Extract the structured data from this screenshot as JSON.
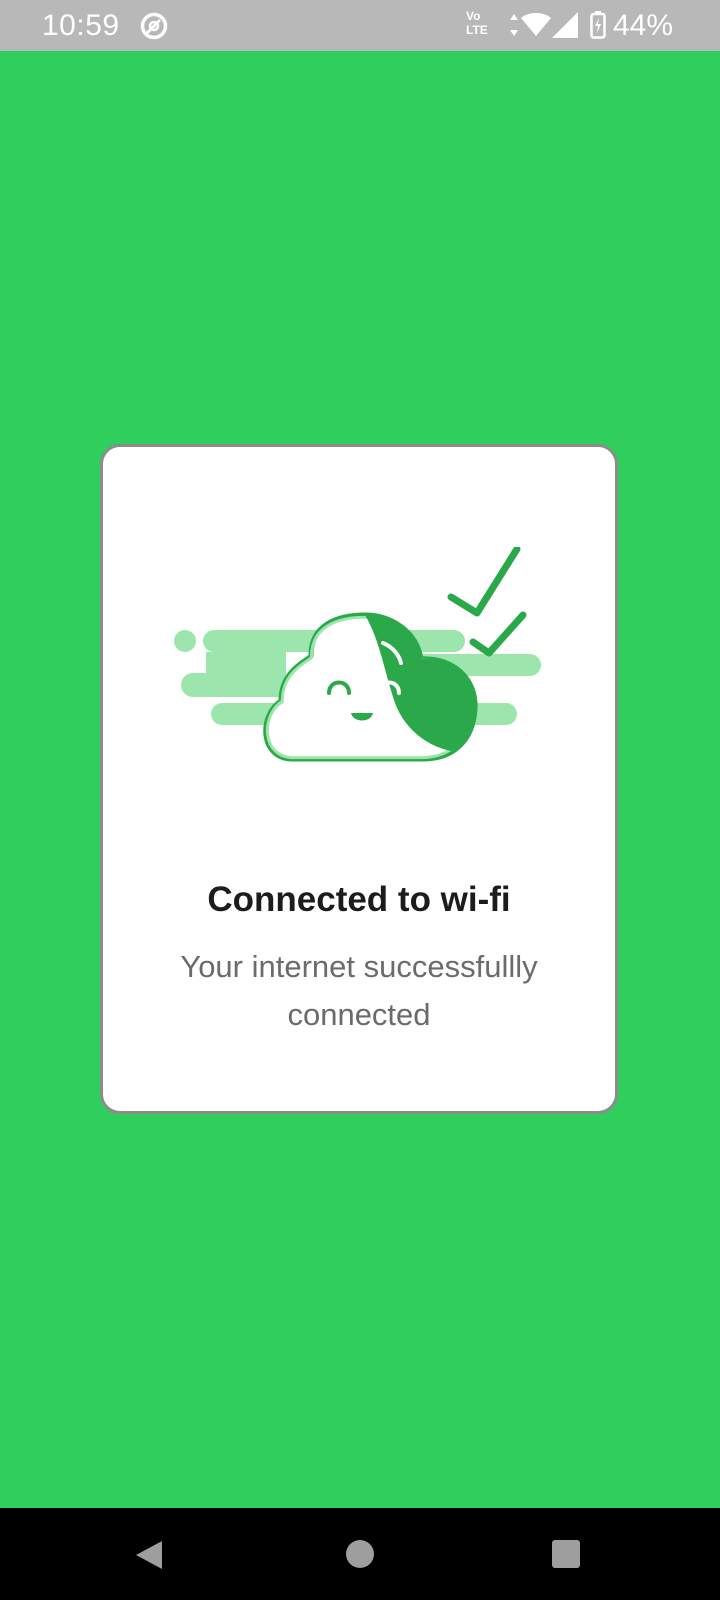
{
  "status_bar": {
    "time": "10:59",
    "volte_top": "Vo",
    "volte_bottom": "LTE",
    "battery_percent": "44%",
    "icons": [
      "app-notification-icon",
      "volte-icon",
      "data-arrows-icon",
      "wifi-icon",
      "cellular-signal-icon",
      "battery-charging-icon"
    ]
  },
  "dialog": {
    "title": "Connected to wi-fi",
    "message": "Your internet successfullly connected",
    "illustration": "happy-cloud-checkmark-icon"
  },
  "nav_bar": {
    "icons": [
      "back-icon",
      "home-icon",
      "recents-icon"
    ]
  },
  "colors": {
    "background": "#30CE5C",
    "status_bar": "#B8B8B8",
    "card": "#FFFFFF",
    "accent_dark": "#2BA84A",
    "accent_light": "#9CE6AE",
    "title_text": "#1C1C1C",
    "message_text": "#6B6B6B",
    "nav_bar": "#000000"
  }
}
